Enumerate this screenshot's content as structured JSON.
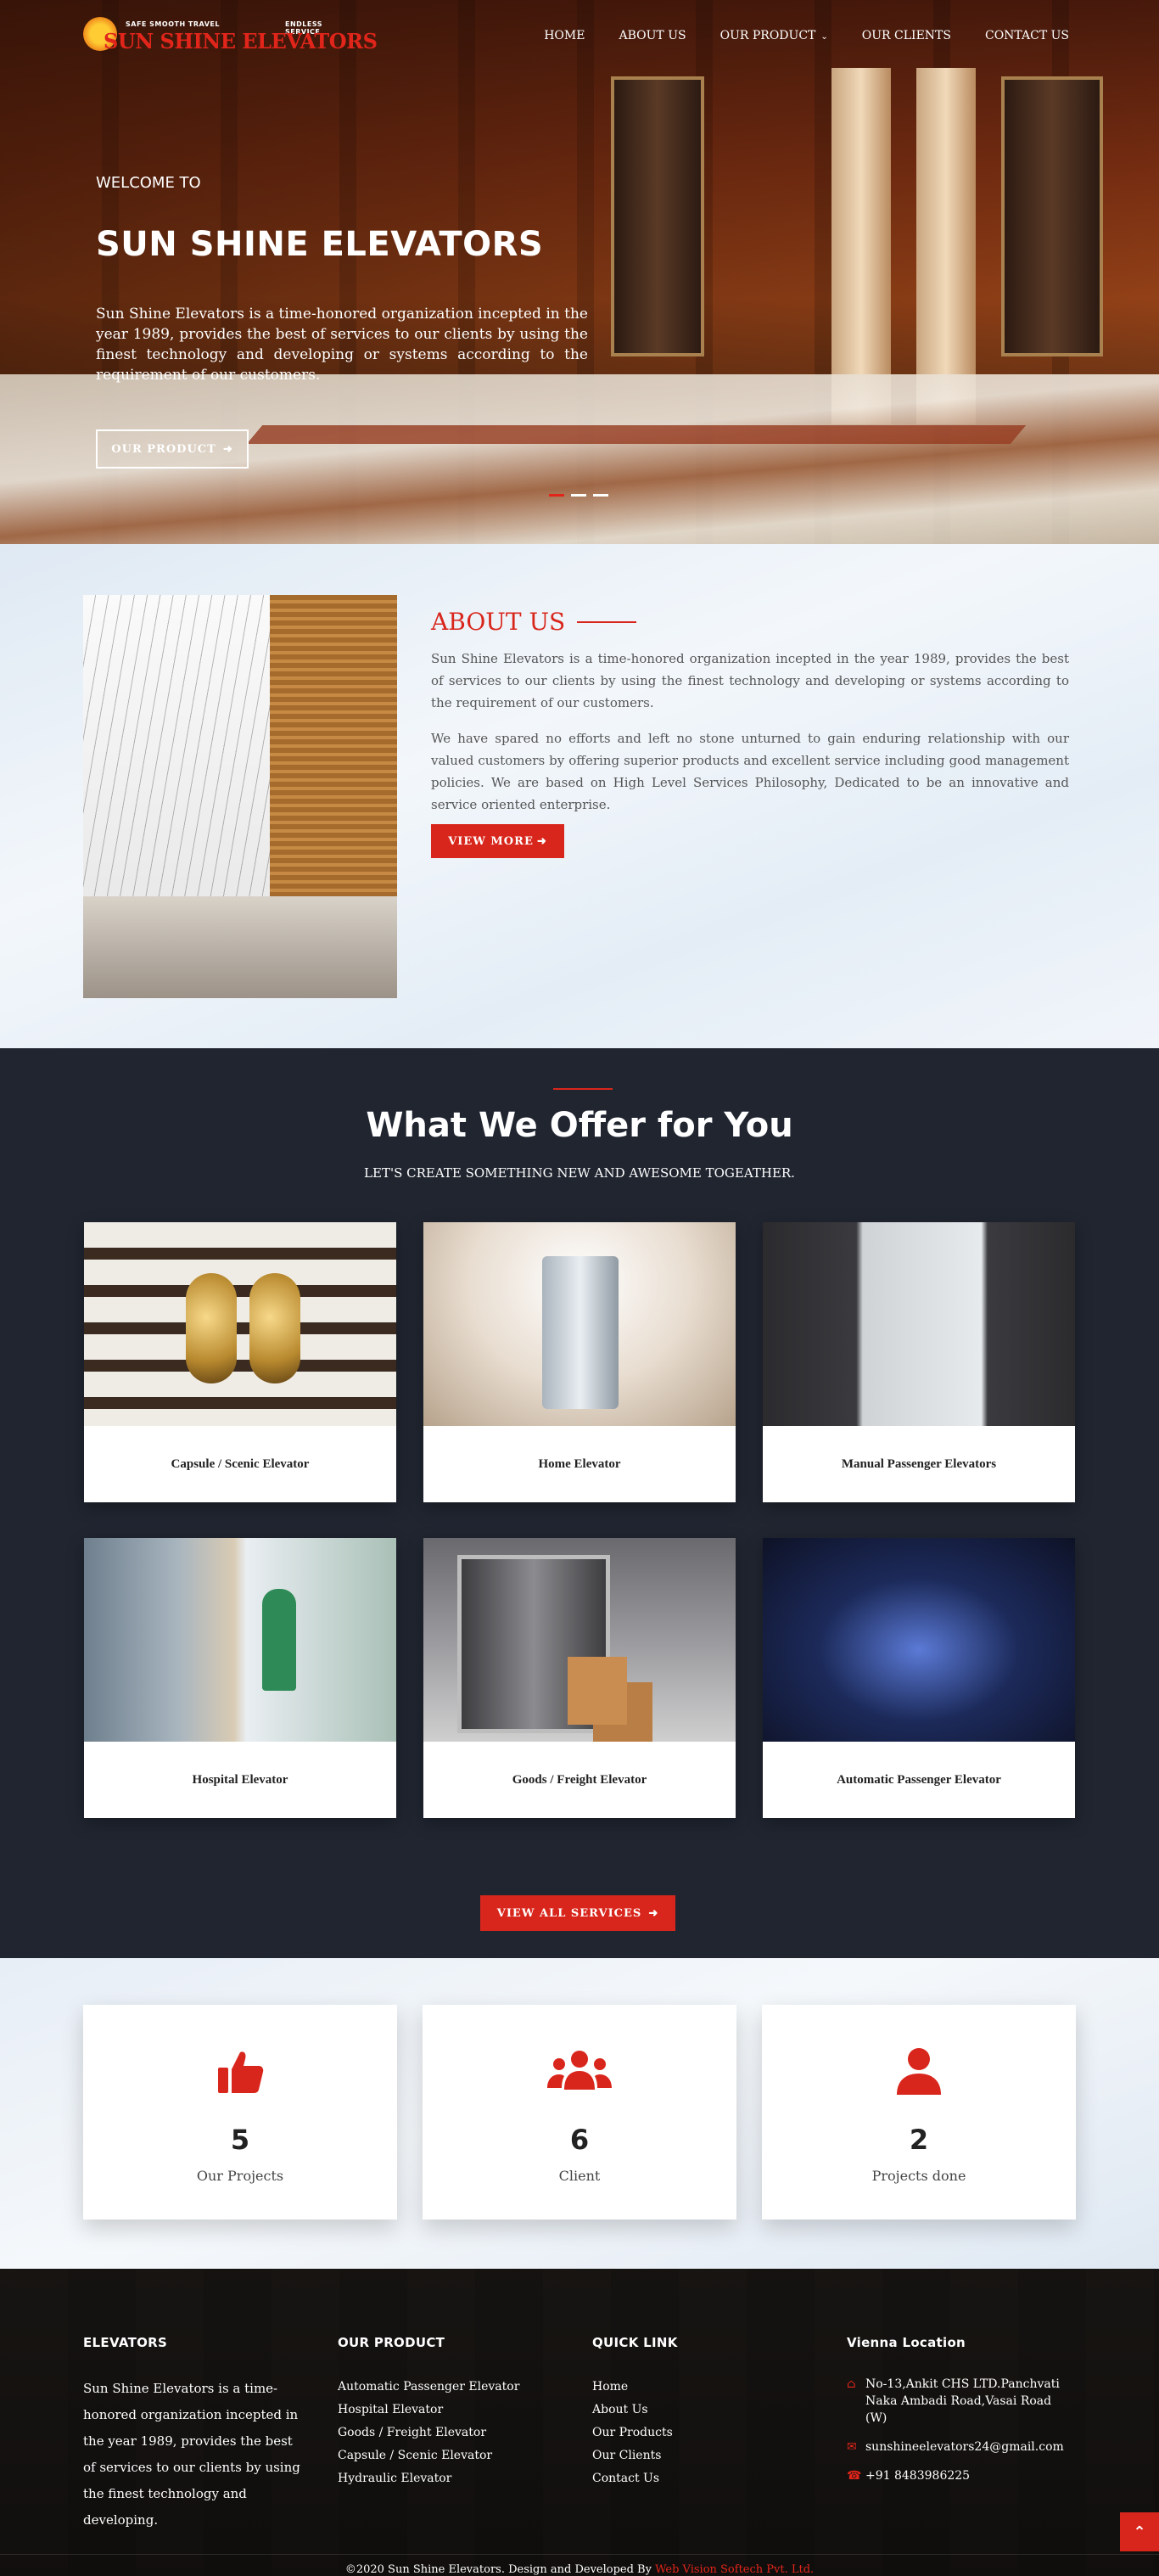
{
  "header": {
    "logo_tag_left": "SAFE SMOOTH   TRAVEL",
    "logo_tag_right": "ENDLESS SERVICE",
    "logo_brand": "SUN SHINE ELEVATORS",
    "nav": [
      "HOME",
      "ABOUT US",
      "OUR PRODUCT",
      "OUR CLIENTS",
      "CONTACT US"
    ]
  },
  "hero": {
    "welcome": "WELCOME TO",
    "title": "SUN SHINE ELEVATORS",
    "description": "Sun Shine Elevators is a time-honored organization incepted in the year 1989, provides the best of services to our clients by using the finest technology and developing or systems according to the requirement of our customers.",
    "button": "OUR PRODUCT",
    "slides": 3,
    "active_slide": 1
  },
  "about": {
    "title": "ABOUT US",
    "paragraph1": "Sun Shine Elevators is a time-honored organization incepted in the year 1989, provides the best of services to our clients by using the finest technology and developing or systems according to the requirement of our customers.",
    "paragraph2": "We have spared no efforts and left no stone unturned to gain enduring relationship with our valued customers by offering superior products and excellent service including good management policies. We are based on High Level Services Philosophy, Dedicated to be an innovative and service oriented enterprise.",
    "button": "VIEW MORE"
  },
  "offer": {
    "title": "What We Offer for You",
    "subtitle": "LET'S CREATE SOMETHING NEW AND AWESOME TOGEATHER.",
    "cards": [
      {
        "label": "Capsule / Scenic Elevator"
      },
      {
        "label": "Home Elevator"
      },
      {
        "label": "Manual Passenger Elevators"
      },
      {
        "label": "Hospital Elevator"
      },
      {
        "label": "Goods / Freight Elevator"
      },
      {
        "label": "Automatic Passenger Elevator"
      }
    ],
    "button": "VIEW ALL SERVICES"
  },
  "stats": [
    {
      "value": "5",
      "label": "Our Projects",
      "icon": "thumbs-up-icon"
    },
    {
      "value": "6",
      "label": "Client",
      "icon": "users-icon"
    },
    {
      "value": "2",
      "label": "Projects done",
      "icon": "user-icon"
    }
  ],
  "footer": {
    "col1_title": "ELEVATORS",
    "col1_text": "Sun Shine Elevators is a time-honored organization incepted in the year 1989, provides the best of services to our clients by using the finest technology and developing.",
    "col2_title": "OUR PRODUCT",
    "col2_links": [
      "Automatic Passenger Elevator",
      "Hospital Elevator",
      "Goods / Freight Elevator",
      "Capsule / Scenic Elevator",
      "Hydraulic Elevator"
    ],
    "col3_title": "QUICK LINK",
    "col3_links": [
      "Home",
      "About Us",
      "Our Products",
      "Our Clients",
      "Contact Us"
    ],
    "col4_title": "Vienna Location",
    "address": "No-13,Ankit CHS LTD.Panchvati Naka Ambadi Road,Vasai Road (W)",
    "email": "sunshineelevators24@gmail.com",
    "phone": "+91 8483986225",
    "copyright_prefix": "©2020 Sun Shine Elevators. Design and Developed By ",
    "copyright_link": "Web Vision Softech Pvt. Ltd."
  },
  "colors": {
    "accent": "#d9261c",
    "dark_bg": "#202530"
  }
}
